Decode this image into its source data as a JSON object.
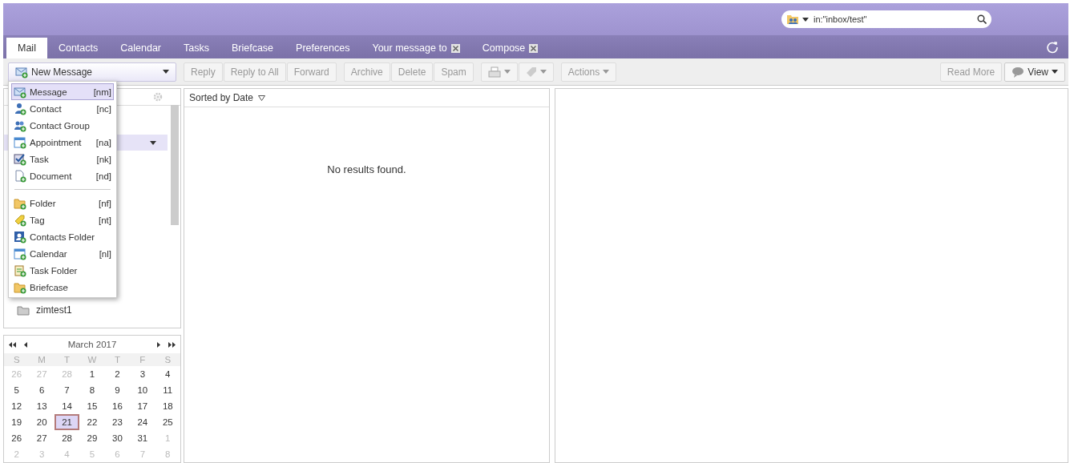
{
  "search": {
    "value": "in:\"inbox/test\""
  },
  "tabs": [
    {
      "label": "Mail",
      "selected": true,
      "closable": false
    },
    {
      "label": "Contacts",
      "selected": false,
      "closable": false
    },
    {
      "label": "Calendar",
      "selected": false,
      "closable": false
    },
    {
      "label": "Tasks",
      "selected": false,
      "closable": false
    },
    {
      "label": "Briefcase",
      "selected": false,
      "closable": false
    },
    {
      "label": "Preferences",
      "selected": false,
      "closable": false
    },
    {
      "label": "Your message to",
      "selected": false,
      "closable": true
    },
    {
      "label": "Compose",
      "selected": false,
      "closable": true
    }
  ],
  "toolbar": {
    "new_button": "New Message",
    "groups": [
      [
        "Reply",
        "Reply to All",
        "Forward"
      ],
      [
        "Archive",
        "Delete",
        "Spam"
      ]
    ],
    "actions": "Actions",
    "read_more": "Read More",
    "view": "View"
  },
  "new_menu": {
    "groups": [
      [
        {
          "kind": "message",
          "label": "Message",
          "shortcut": "[nm]",
          "selected": true
        },
        {
          "kind": "contact",
          "label": "Contact",
          "shortcut": "[nc]",
          "selected": false
        },
        {
          "kind": "group",
          "label": "Contact Group",
          "selected": false
        },
        {
          "kind": "calendar",
          "label": "Appointment",
          "shortcut": "[na]",
          "selected": false
        },
        {
          "kind": "task",
          "label": "Task",
          "shortcut": "[nk]",
          "selected": false
        },
        {
          "kind": "document",
          "label": "Document",
          "shortcut": "[nd]",
          "selected": false
        }
      ],
      [
        {
          "kind": "folder",
          "label": "Folder",
          "shortcut": "[nf]",
          "selected": false
        },
        {
          "kind": "tag",
          "label": "Tag",
          "shortcut": "[nt]",
          "selected": false
        },
        {
          "kind": "contactsfolder",
          "label": "Contacts Folder",
          "selected": false
        },
        {
          "kind": "calendar",
          "label": "Calendar",
          "shortcut": "[nl]",
          "selected": false
        },
        {
          "kind": "taskfolder",
          "label": "Task Folder",
          "selected": false
        },
        {
          "kind": "folder",
          "label": "Briefcase",
          "selected": false
        }
      ]
    ]
  },
  "folders": [
    {
      "label": "zimtest1"
    }
  ],
  "list": {
    "sort": "Sorted by Date",
    "empty": "No results found."
  },
  "calendar": {
    "title": "March 2017",
    "weekdays": [
      "S",
      "M",
      "T",
      "W",
      "T",
      "F",
      "S"
    ],
    "weeks": [
      [
        {
          "day": "26",
          "muted": true,
          "selected": false
        },
        {
          "day": "27",
          "muted": true,
          "selected": false
        },
        {
          "day": "28",
          "muted": true,
          "selected": false
        },
        {
          "day": "1",
          "muted": false,
          "selected": false
        },
        {
          "day": "2",
          "muted": false,
          "selected": false
        },
        {
          "day": "3",
          "muted": false,
          "selected": false
        },
        {
          "day": "4",
          "muted": false,
          "selected": false
        }
      ],
      [
        {
          "day": "5",
          "muted": false,
          "selected": false
        },
        {
          "day": "6",
          "muted": false,
          "selected": false
        },
        {
          "day": "7",
          "muted": false,
          "selected": false
        },
        {
          "day": "8",
          "muted": false,
          "selected": false
        },
        {
          "day": "9",
          "muted": false,
          "selected": false
        },
        {
          "day": "10",
          "muted": false,
          "selected": false
        },
        {
          "day": "11",
          "muted": false,
          "selected": false
        }
      ],
      [
        {
          "day": "12",
          "muted": false,
          "selected": false
        },
        {
          "day": "13",
          "muted": false,
          "selected": false
        },
        {
          "day": "14",
          "muted": false,
          "selected": false
        },
        {
          "day": "15",
          "muted": false,
          "selected": false
        },
        {
          "day": "16",
          "muted": false,
          "selected": false
        },
        {
          "day": "17",
          "muted": false,
          "selected": false
        },
        {
          "day": "18",
          "muted": false,
          "selected": false
        }
      ],
      [
        {
          "day": "19",
          "muted": false,
          "selected": false
        },
        {
          "day": "20",
          "muted": false,
          "selected": false
        },
        {
          "day": "21",
          "muted": false,
          "selected": true
        },
        {
          "day": "22",
          "muted": false,
          "selected": false
        },
        {
          "day": "23",
          "muted": false,
          "selected": false
        },
        {
          "day": "24",
          "muted": false,
          "selected": false
        },
        {
          "day": "25",
          "muted": false,
          "selected": false
        }
      ],
      [
        {
          "day": "26",
          "muted": false,
          "selected": false
        },
        {
          "day": "27",
          "muted": false,
          "selected": false
        },
        {
          "day": "28",
          "muted": false,
          "selected": false
        },
        {
          "day": "29",
          "muted": false,
          "selected": false
        },
        {
          "day": "30",
          "muted": false,
          "selected": false
        },
        {
          "day": "31",
          "muted": false,
          "selected": false
        },
        {
          "day": "1",
          "muted": true,
          "selected": false
        }
      ],
      [
        {
          "day": "2",
          "muted": true,
          "selected": false
        },
        {
          "day": "3",
          "muted": true,
          "selected": false
        },
        {
          "day": "4",
          "muted": true,
          "selected": false
        },
        {
          "day": "5",
          "muted": true,
          "selected": false
        },
        {
          "day": "6",
          "muted": true,
          "selected": false
        },
        {
          "day": "7",
          "muted": true,
          "selected": false
        },
        {
          "day": "8",
          "muted": true,
          "selected": false
        }
      ]
    ]
  }
}
